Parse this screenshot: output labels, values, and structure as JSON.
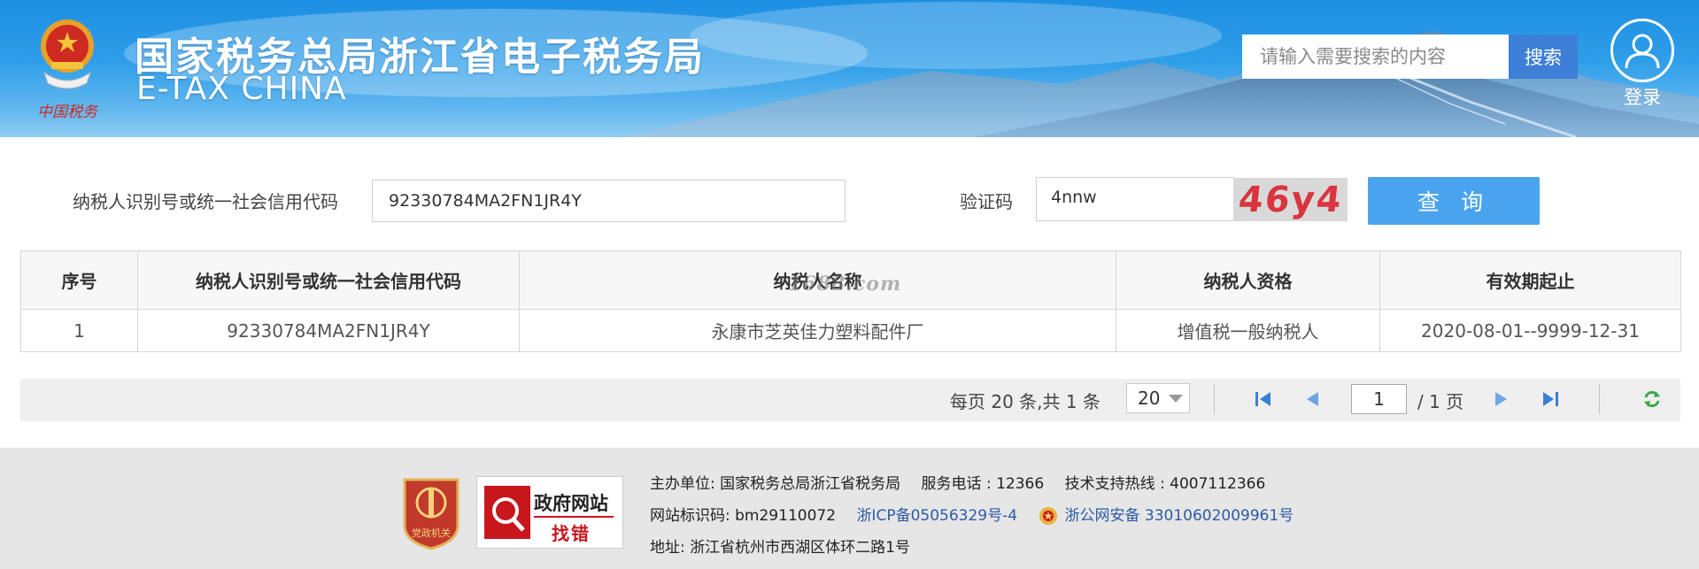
{
  "header": {
    "title_cn": "国家税务总局浙江省电子税务局",
    "title_en": "E-TAX CHINA",
    "emblem_caption": "中国税务",
    "search_placeholder": "请输入需要搜索的内容",
    "search_button": "搜索",
    "login_label": "登录"
  },
  "form": {
    "taxid_label": "纳税人识别号或统一社会信用代码",
    "taxid_value": "92330784MA2FN1JR4Y",
    "captcha_label": "验证码",
    "captcha_value": "4nnw",
    "captcha_image_text": "46y4",
    "query_button": "查 询"
  },
  "table": {
    "headers": [
      "序号",
      "纳税人识别号或统一社会信用代码",
      "纳税人名称",
      "纳税人资格",
      "有效期起止"
    ],
    "rows": [
      [
        "1",
        "92330784MA2FN1JR4Y",
        "永康市芝英佳力塑料配件厂",
        "增值税一般纳税人",
        "2020-08-01--9999-12-31"
      ]
    ],
    "watermark": "1688.com"
  },
  "pager": {
    "summary": "每页 20 条,共 1 条",
    "page_size": "20",
    "current_page": "1",
    "total_pages": "/ 1 页"
  },
  "footer": {
    "party_badge_text": "党政机关",
    "gov_badge_line1": "政府网站",
    "gov_badge_line2": "找错",
    "host_label": "主办单位:",
    "host_value": "国家税务总局浙江省税务局",
    "phone_label": "服务电话 :",
    "phone_value": "12366",
    "hotline_label": "技术支持热线 :",
    "hotline_value": "4007112366",
    "site_id_label": "网站标识码:",
    "site_id_value": "bm29110072",
    "icp": "浙ICP备05056329号-4",
    "police_record": "浙公网安备 33010602009961号",
    "address_label": "地址:",
    "address_value": "浙江省杭州市西湖区体环二路1号"
  },
  "colors": {
    "header_blue": "#1d8fe2",
    "search_button": "#3d7fd6",
    "query_button": "#4aa3ee",
    "captcha_text": "#d9343f",
    "link_blue": "#2d5aa6",
    "pager_icon": "#3a7fd5",
    "refresh_icon": "#3aa84a"
  }
}
